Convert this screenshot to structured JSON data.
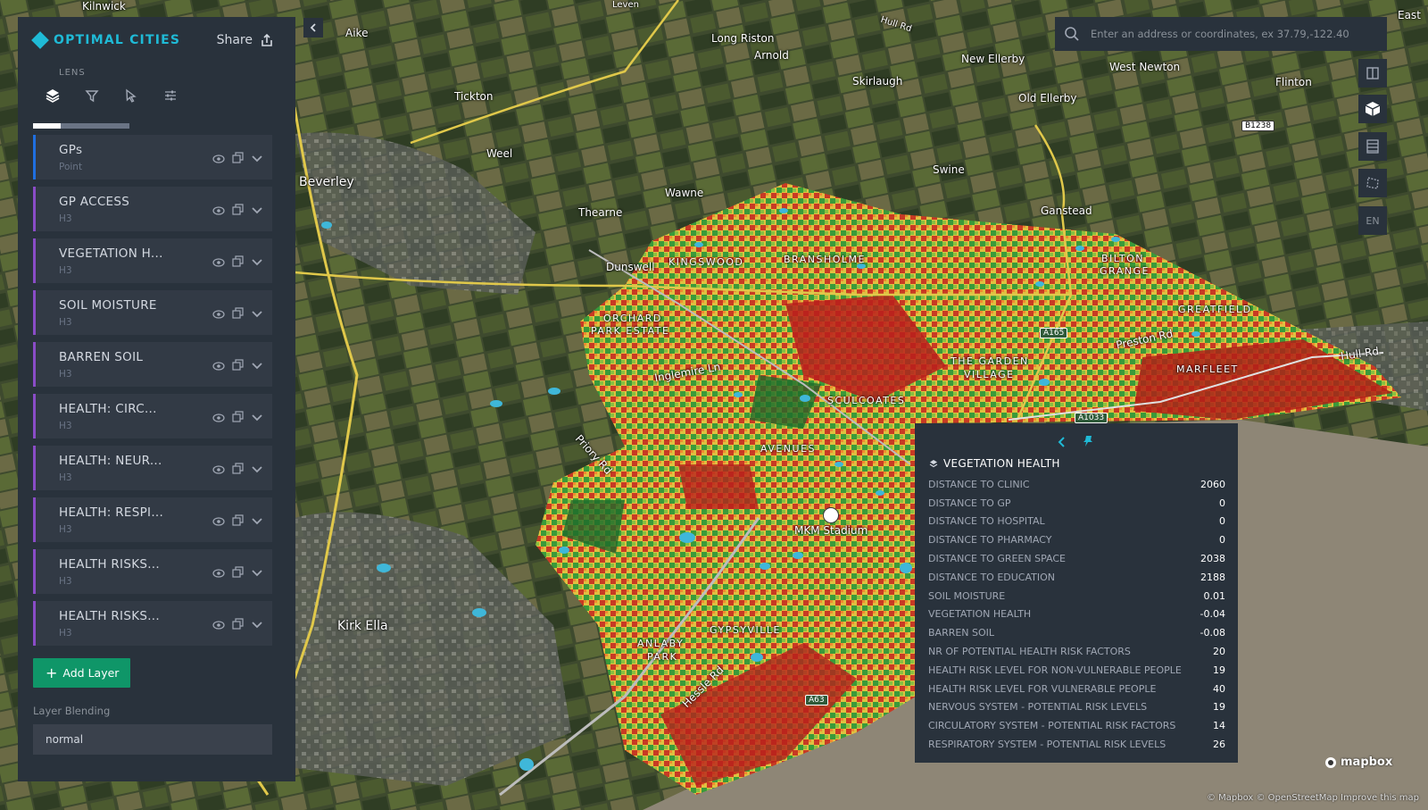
{
  "app": {
    "brand": "OPTIMAL CITIES",
    "subtitle": "LENS",
    "share_label": "Share",
    "tabs": [
      "layers-icon",
      "filter-icon",
      "interaction-icon",
      "settings-icon"
    ]
  },
  "layers": [
    {
      "name": "GPs",
      "type": "Point",
      "color": "#1f6fe0"
    },
    {
      "name": "GP ACCESS",
      "type": "H3",
      "color": "#8a4cc7"
    },
    {
      "name": "VEGETATION H...",
      "type": "H3",
      "color": "#8a4cc7"
    },
    {
      "name": "SOIL MOISTURE",
      "type": "H3",
      "color": "#8a4cc7"
    },
    {
      "name": "BARREN SOIL",
      "type": "H3",
      "color": "#8a4cc7"
    },
    {
      "name": "HEALTH: CIRC...",
      "type": "H3",
      "color": "#8a4cc7"
    },
    {
      "name": "HEALTH: NEUR...",
      "type": "H3",
      "color": "#8a4cc7"
    },
    {
      "name": "HEALTH: RESPI...",
      "type": "H3",
      "color": "#8a4cc7"
    },
    {
      "name": "HEALTH RISKS...",
      "type": "H3",
      "color": "#8a4cc7"
    },
    {
      "name": "HEALTH RISKS...",
      "type": "H3",
      "color": "#8a4cc7"
    }
  ],
  "add_layer_label": "Add Layer",
  "blending": {
    "label": "Layer Blending",
    "value": "normal"
  },
  "search": {
    "placeholder": "Enter an address or coordinates, ex 37.79,-122.40"
  },
  "right_tools": {
    "lang": "EN"
  },
  "tooltip": {
    "title": "VEGETATION HEALTH",
    "rows": [
      {
        "k": "DISTANCE TO CLINIC",
        "v": "2060"
      },
      {
        "k": "DISTANCE TO GP",
        "v": "0"
      },
      {
        "k": "DISTANCE TO HOSPITAL",
        "v": "0"
      },
      {
        "k": "DISTANCE TO PHARMACY",
        "v": "0"
      },
      {
        "k": "DISTANCE TO GREEN SPACE",
        "v": "2038"
      },
      {
        "k": "DISTANCE TO EDUCATION",
        "v": "2188"
      },
      {
        "k": "SOIL MOISTURE",
        "v": "0.01"
      },
      {
        "k": "VEGETATION HEALTH",
        "v": "-0.04"
      },
      {
        "k": "BARREN SOIL",
        "v": "-0.08"
      },
      {
        "k": "NR OF POTENTIAL HEALTH RISK FACTORS",
        "v": "20"
      },
      {
        "k": "HEALTH RISK LEVEL FOR NON-VULNERABLE PEOPLE",
        "v": "19"
      },
      {
        "k": "HEALTH RISK LEVEL FOR VULNERABLE PEOPLE",
        "v": "40"
      },
      {
        "k": "NERVOUS SYSTEM - POTENTIAL RISK LEVELS",
        "v": "19"
      },
      {
        "k": "CIRCULATORY SYSTEM - POTENTIAL RISK FACTORS",
        "v": "14"
      },
      {
        "k": "RESPIRATORY SYSTEM - POTENTIAL RISK LEVELS",
        "v": "26"
      }
    ]
  },
  "map": {
    "places": [
      "Kilnwick",
      "Aike",
      "Long Riston",
      "Arnold",
      "New Ellerby",
      "West Newton",
      "Flinton",
      "Skirlaugh",
      "Old Ellerby",
      "Tickton",
      "Beverley",
      "Weel",
      "Swine",
      "Wawne",
      "Thearne",
      "Ganstead",
      "Dunswell",
      "Kirk Ella",
      "MKM Stadium",
      "Hull Rd",
      "East",
      "Leven"
    ],
    "districts": [
      "KINGSWOOD",
      "BRANSHOLME",
      "BILTON",
      "GRANGE",
      "GREATFIELD",
      "ORCHARD",
      "PARK ESTATE",
      "THE GARDEN",
      "VILLAGE",
      "MARFLEET",
      "SCULCOATES",
      "AVENUES",
      "GYPSYVILLE",
      "ANLABY",
      "PARK"
    ],
    "roads": [
      "Inglemire Ln",
      "Priory Rd",
      "Preston Rd",
      "Hessle Rd",
      "Hull Rd",
      "A165",
      "A1033",
      "A63",
      "B1238"
    ]
  },
  "attribution": {
    "brand": "mapbox",
    "text": "© Mapbox © OpenStreetMap Improve this map"
  }
}
